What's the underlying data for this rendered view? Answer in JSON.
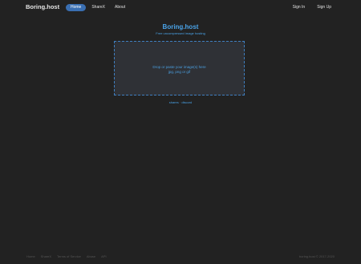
{
  "navbar": {
    "brand": "Boring.host",
    "links": [
      "Home",
      "ShareX",
      "About"
    ],
    "right_links": [
      "Sign In",
      "Sign Up"
    ]
  },
  "hero": {
    "title": "Boring.host",
    "subtitle": "Free uncompressed image hosting"
  },
  "dropzone": {
    "line1": "Drop or paste your image(s) here",
    "line2": "jpg, png or gif"
  },
  "social": {
    "link1": "shares",
    "separator": "·",
    "link2": "discord"
  },
  "footer": {
    "links": [
      "Home",
      "ShareX",
      "Terms of Service",
      "Abuse",
      "API"
    ],
    "copyright": "boring.host © 2017-2020"
  },
  "colors": {
    "background": "#222222",
    "accent": "#4aa3e8",
    "active_nav": "#3a6fb2",
    "dropzone_border": "#3f7fc0",
    "dropzone_bg": "#2f3136"
  }
}
